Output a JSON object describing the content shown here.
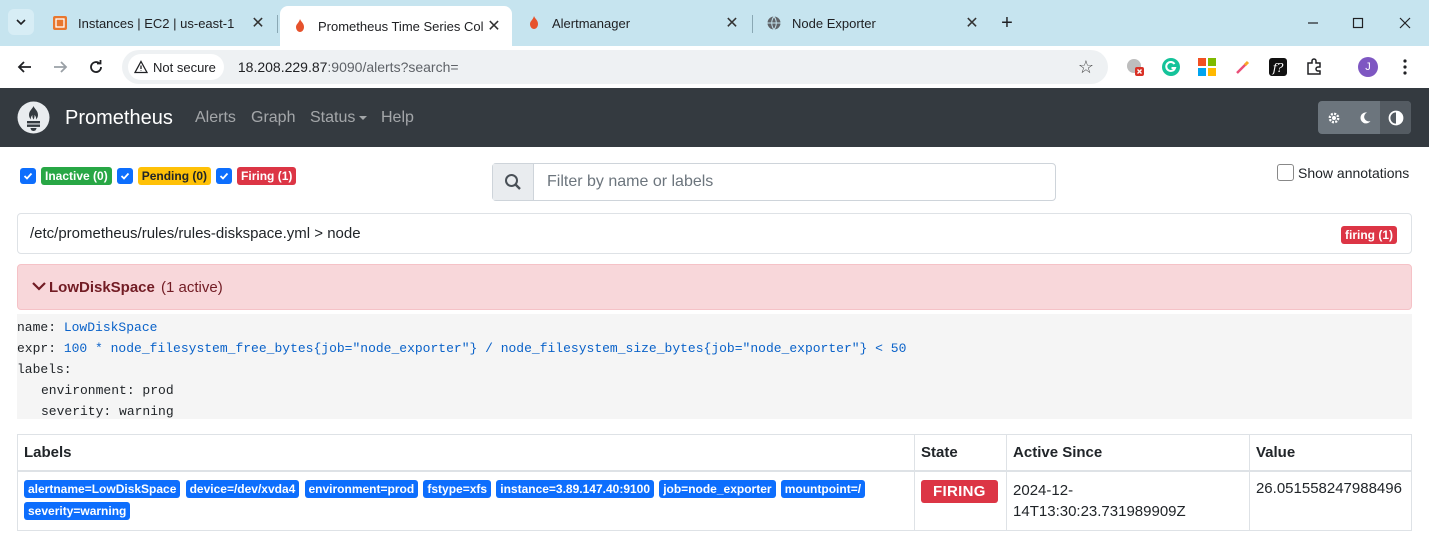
{
  "browser": {
    "tabs": [
      {
        "title": "Instances | EC2 | us-east-1",
        "active": false
      },
      {
        "title": "Prometheus Time Series Collect",
        "active": true
      },
      {
        "title": "Alertmanager",
        "active": false
      },
      {
        "title": "Node Exporter",
        "active": false
      }
    ],
    "security_label": "Not secure",
    "url_host": "18.208.229.87",
    "url_rest": ":9090/alerts?search=",
    "profile_initial": "J"
  },
  "navbar": {
    "brand": "Prometheus",
    "links": {
      "alerts": "Alerts",
      "graph": "Graph",
      "status": "Status",
      "help": "Help"
    }
  },
  "filters": {
    "inactive": "Inactive (0)",
    "pending": "Pending (0)",
    "firing": "Firing (1)"
  },
  "search": {
    "placeholder": "Filter by name or labels",
    "value": ""
  },
  "show_annotations_label": "Show annotations",
  "rule_group": {
    "path": "/etc/prometheus/rules/rules-diskspace.yml > node",
    "badge": "firing (1)"
  },
  "rule": {
    "name": "LowDiskSpace",
    "active_count": "(1 active)",
    "yaml": {
      "name_key": "name:",
      "name_value": "LowDiskSpace",
      "expr_key": "expr:",
      "expr_value": "100 * node_filesystem_free_bytes{job=\"node_exporter\"} / node_filesystem_size_bytes{job=\"node_exporter\"} < 50",
      "labels_key": "labels:",
      "label_lines": [
        "environment: prod",
        "severity: warning"
      ]
    }
  },
  "alerts_table": {
    "headers": {
      "labels": "Labels",
      "state": "State",
      "active_since": "Active Since",
      "value": "Value"
    },
    "rows": [
      {
        "labels": [
          "alertname=LowDiskSpace",
          "device=/dev/xvda4",
          "environment=prod",
          "fstype=xfs",
          "instance=3.89.147.40:9100",
          "job=node_exporter",
          "mountpoint=/",
          "severity=warning"
        ],
        "state": "FIRING",
        "active_since": "2024-12-14T13:30:23.731989909Z",
        "value": "26.051558247988496"
      }
    ]
  },
  "colors": {
    "firing": "#dc3545",
    "pending": "#ffc107",
    "inactive": "#28a745",
    "label": "#0d6efd",
    "navbar": "#343a40"
  }
}
